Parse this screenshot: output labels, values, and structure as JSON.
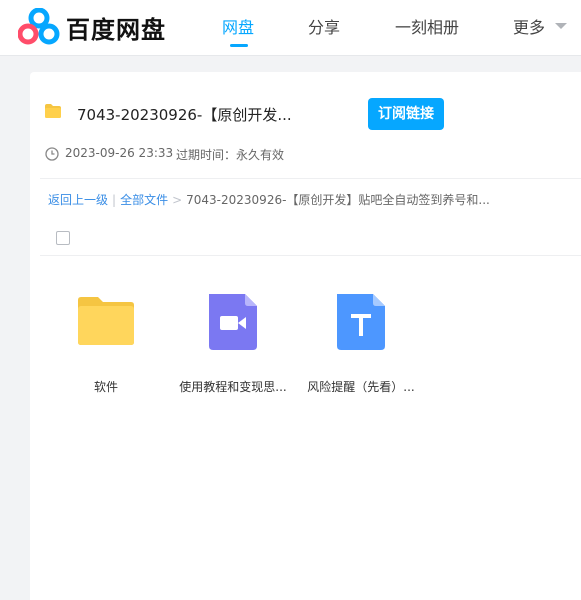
{
  "header": {
    "logo_text": "百度网盘",
    "nav": [
      {
        "label": "网盘",
        "active": true
      },
      {
        "label": "分享",
        "active": false
      },
      {
        "label": "一刻相册",
        "active": false
      },
      {
        "label": "更多",
        "active": false
      }
    ]
  },
  "share": {
    "title": "7043-20230926-【原创开发...",
    "subscribe_label": "订阅链接",
    "date": "2023-09-26 23:33",
    "expire": "过期时间：永久有效"
  },
  "breadcrumb": {
    "back": "返回上一级",
    "sep": "|",
    "all_files": "全部文件",
    "arrow": ">",
    "current": "7043-20230926-【原创开发】贴吧全自动签到养号和..."
  },
  "files": [
    {
      "name": "软件",
      "type": "folder",
      "icon": "folder-icon"
    },
    {
      "name": "使用教程和变现思...",
      "type": "video",
      "icon": "video-file-icon"
    },
    {
      "name": "风险提醒（先看）...",
      "type": "text",
      "icon": "text-file-icon"
    }
  ],
  "colors": {
    "accent": "#06a7ff",
    "folder": "#ffd04b",
    "video": "#7b78f2",
    "text_doc": "#4d97ff",
    "link": "#3a8ee6"
  }
}
